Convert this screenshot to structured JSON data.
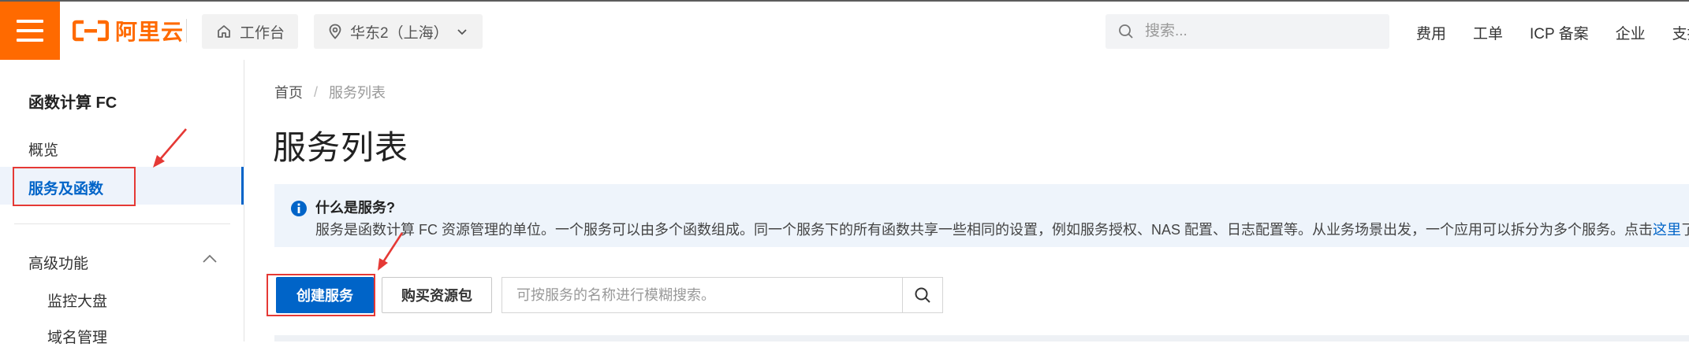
{
  "header": {
    "menu_icon": "hamburger-menu-icon",
    "logo_text": "阿里云",
    "console_label": "工作台",
    "region_label": "华东2（上海）",
    "search_placeholder": "搜索...",
    "nav": [
      "费用",
      "工单",
      "ICP 备案",
      "企业",
      "支持"
    ],
    "accent_color": "#ff6a00"
  },
  "sidebar": {
    "title": "函数计算 FC",
    "items": [
      {
        "label": "概览",
        "active": false
      },
      {
        "label": "服务及函数",
        "active": true
      }
    ],
    "advanced": {
      "label": "高级功能",
      "expanded": true,
      "children": [
        "监控大盘",
        "域名管理"
      ]
    },
    "active_color": "#0064c8"
  },
  "main": {
    "breadcrumb": [
      "首页",
      "服务列表"
    ],
    "page_title": "服务列表",
    "notice": {
      "icon": "info-icon",
      "title": "什么是服务?",
      "text": "服务是函数计算 FC 资源管理的单位。一个服务可以由多个函数组成。同一个服务下的所有函数共享一些相同的设置，例如服务授权、NAS 配置、日志配置等。从业务场景出发，一个应用可以拆分为多个服务。点击",
      "link": "这里",
      "tail": "了"
    },
    "buttons": {
      "create": "创建服务",
      "buy": "购买资源包"
    },
    "search_placeholder": "可按服务的名称进行模糊搜索。"
  },
  "annotations": {
    "highlight_color": "#e53935"
  }
}
